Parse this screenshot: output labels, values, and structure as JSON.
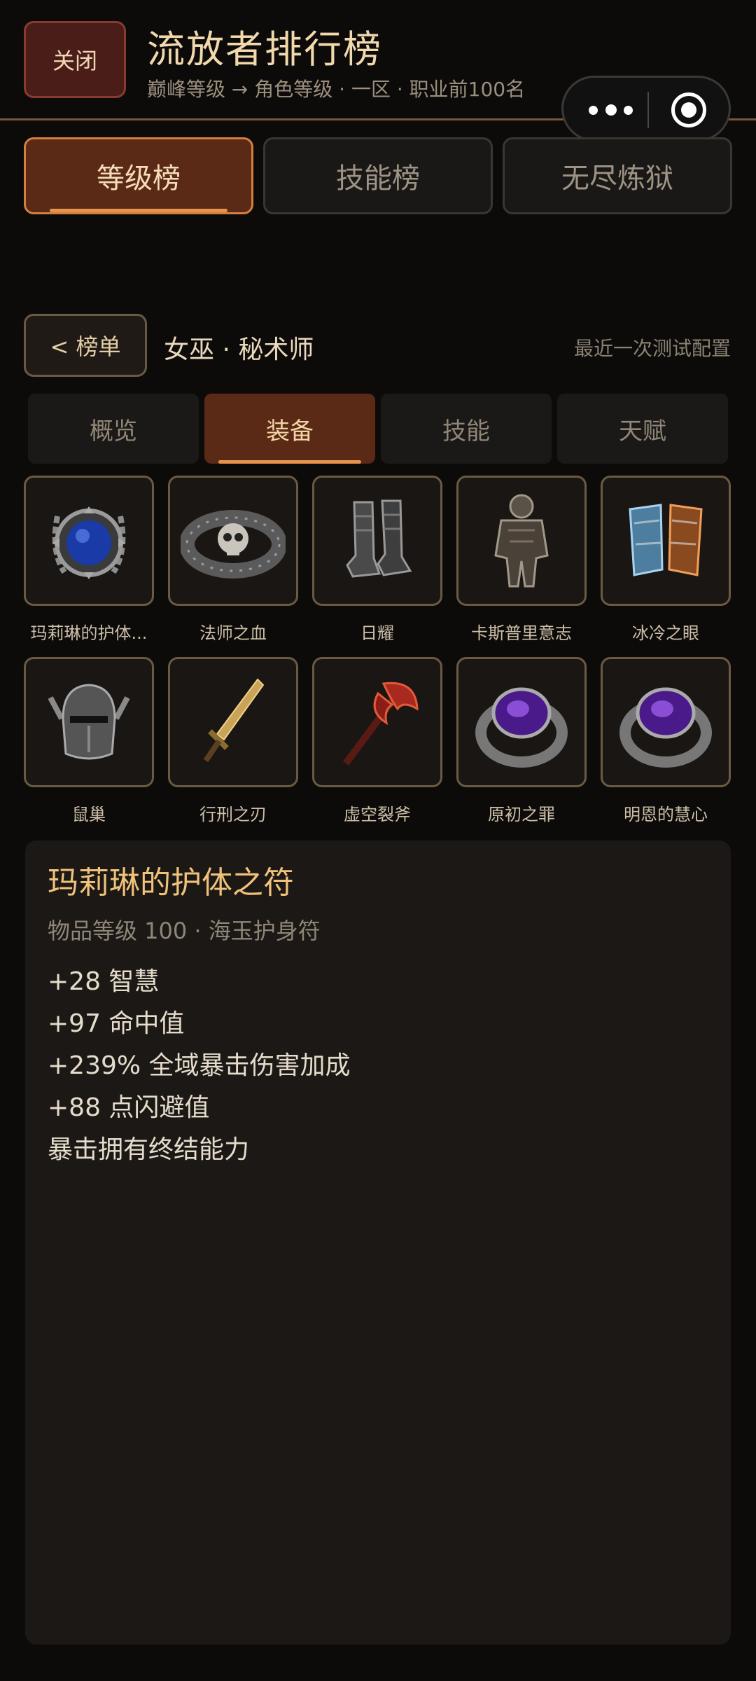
{
  "header": {
    "close_label": "关闭",
    "title": "流放者排行榜",
    "subtitle": "巅峰等级 → 角色等级 · 一区 · 职业前100名"
  },
  "top_tabs": [
    {
      "label": "等级榜",
      "active": true
    },
    {
      "label": "技能榜",
      "active": false
    },
    {
      "label": "无尽炼狱",
      "active": false
    }
  ],
  "nav": {
    "back_label": "< 榜单",
    "role": "女巫 · 秘术师",
    "config": "最近一次测试配置"
  },
  "sub_tabs": [
    {
      "label": "概览",
      "active": false
    },
    {
      "label": "装备",
      "active": true
    },
    {
      "label": "技能",
      "active": false
    },
    {
      "label": "天赋",
      "active": false
    }
  ],
  "equipment": [
    {
      "name": "玛莉琳的护体之符",
      "display": "玛莉琳的护体...",
      "icon": "amulet-icon"
    },
    {
      "name": "法师之血",
      "display": "法师之血",
      "icon": "skull-belt-icon"
    },
    {
      "name": "日耀",
      "display": "日耀",
      "icon": "boots-icon"
    },
    {
      "name": "卡斯普里意志",
      "display": "卡斯普里意志",
      "icon": "armor-icon"
    },
    {
      "name": "冰冷之眼",
      "display": "冰冷之眼",
      "icon": "gloves-icon"
    },
    {
      "name": "鼠巢",
      "display": "鼠巢",
      "icon": "helmet-icon"
    },
    {
      "name": "行刑之刃",
      "display": "行刑之刃",
      "icon": "sword-icon"
    },
    {
      "name": "虚空裂斧",
      "display": "虚空裂斧",
      "icon": "axe-icon"
    },
    {
      "name": "原初之罪",
      "display": "原初之罪",
      "icon": "ring-icon"
    },
    {
      "name": "明恩的慧心",
      "display": "明恩的慧心",
      "icon": "ring-icon"
    }
  ],
  "detail": {
    "name": "玛莉琳的护体之符",
    "meta": "物品等级 100 · 海玉护身符",
    "stats": [
      "+28 智慧",
      "+97 命中值",
      "+239% 全域暴击伤害加成",
      "+88 点闪避值",
      "暴击拥有终结能力"
    ]
  },
  "colors": {
    "accent": "#e7934c",
    "title_gold": "#f0c27a",
    "slot_border": "#6b5a43"
  }
}
